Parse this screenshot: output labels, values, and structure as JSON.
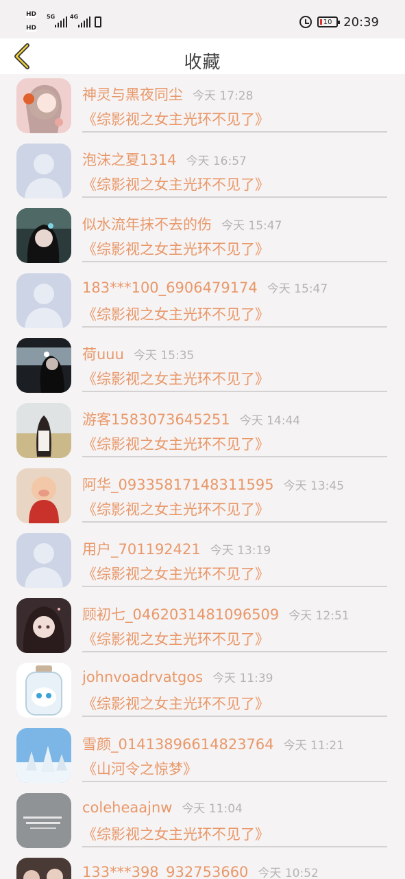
{
  "status_bar": {
    "left": {
      "sim1": "HD",
      "sim2": "HD",
      "net1": "5G",
      "net2": "4G"
    },
    "battery": "10",
    "time": "20:39"
  },
  "header": {
    "title": "收藏",
    "back_icon": "chevron-left-icon"
  },
  "colors": {
    "accent": "#e89869",
    "time": "#b4b4b4",
    "divider": "#d4d1d2",
    "placeholder_avatar": "#cfd6e6"
  },
  "items": [
    {
      "name": "神灵与黑夜同尘",
      "time": "今天 17:28",
      "book": "《综影视之女主光环不见了》",
      "avatar": "photo-girl-flowers"
    },
    {
      "name": "泡沫之夏1314",
      "time": "今天 16:57",
      "book": "《综影视之女主光环不见了》",
      "avatar": "default-avatar"
    },
    {
      "name": "似水流年抹不去的伤",
      "time": "今天 15:47",
      "book": "《综影视之女主光环不见了》",
      "avatar": "photo-girl-car"
    },
    {
      "name": "183***100_6906479174",
      "time": "今天 15:47",
      "book": "《综影视之女主光环不见了》",
      "avatar": "default-avatar"
    },
    {
      "name": "荷uuu",
      "time": "今天 15:35",
      "book": "《综影视之女主光环不见了》",
      "avatar": "photo-girl-window"
    },
    {
      "name": "游客1583073645251",
      "time": "今天 14:44",
      "book": "《综影视之女主光环不见了》",
      "avatar": "photo-girl-field"
    },
    {
      "name": "阿华_09335817148311595",
      "time": "今天 13:45",
      "book": "《综影视之女主光环不见了》",
      "avatar": "photo-pig-toy"
    },
    {
      "name": "用户_701192421",
      "time": "今天 13:19",
      "book": "《综影视之女主光环不见了》",
      "avatar": "default-avatar"
    },
    {
      "name": "顾初七_0462031481096509",
      "time": "今天 12:51",
      "book": "《综影视之女主光环不见了》",
      "avatar": "photo-anime-girl"
    },
    {
      "name": "johnvoadrvatgos",
      "time": "今天 11:39",
      "book": "《综影视之女主光环不见了》",
      "avatar": "photo-cat-jar"
    },
    {
      "name": "雪颜_01413896614823764",
      "time": "今天 11:21",
      "book": "《山河令之惊梦》",
      "avatar": "photo-snow-trees"
    },
    {
      "name": "coleheaajnw",
      "time": "今天 11:04",
      "book": "《综影视之女主光环不见了》",
      "avatar": "photo-text-card"
    },
    {
      "name": "133***398_932753660",
      "time": "今天 10:52",
      "book": "",
      "avatar": "photo-people"
    }
  ]
}
